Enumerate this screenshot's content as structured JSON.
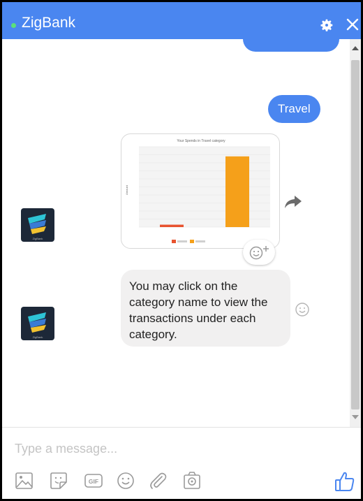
{
  "header": {
    "title": "ZigBank",
    "online_color": "#5be07a",
    "background_color": "#4a86f0",
    "icons": [
      "gear-icon",
      "close-icon"
    ]
  },
  "messages": {
    "user_message": "Travel",
    "chart_card": {
      "chart_data": {
        "type": "bar",
        "title": "Your Spends in Travel category",
        "ylabel": "Amount",
        "categories": [
          "[unclear]",
          "[unclear]"
        ],
        "series": [
          {
            "name": "[unclear]",
            "color": "#e8532f",
            "values": [
              3,
              null
            ]
          },
          {
            "name": "[unclear]",
            "color": "#f5a01a",
            "values": [
              null,
              88
            ]
          }
        ],
        "ylim": [
          0,
          100
        ],
        "grid": true,
        "legend": "bottom"
      }
    },
    "bot_message": "You may click on the category name to view the transactions under each category.",
    "avatar_label": "ZigBank"
  },
  "composer": {
    "placeholder": "Type a message...",
    "tools": [
      "image-icon",
      "sticker-icon",
      "gif-icon",
      "emoji-icon",
      "attachment-icon",
      "camera-icon"
    ],
    "gif_label": "GIF"
  }
}
